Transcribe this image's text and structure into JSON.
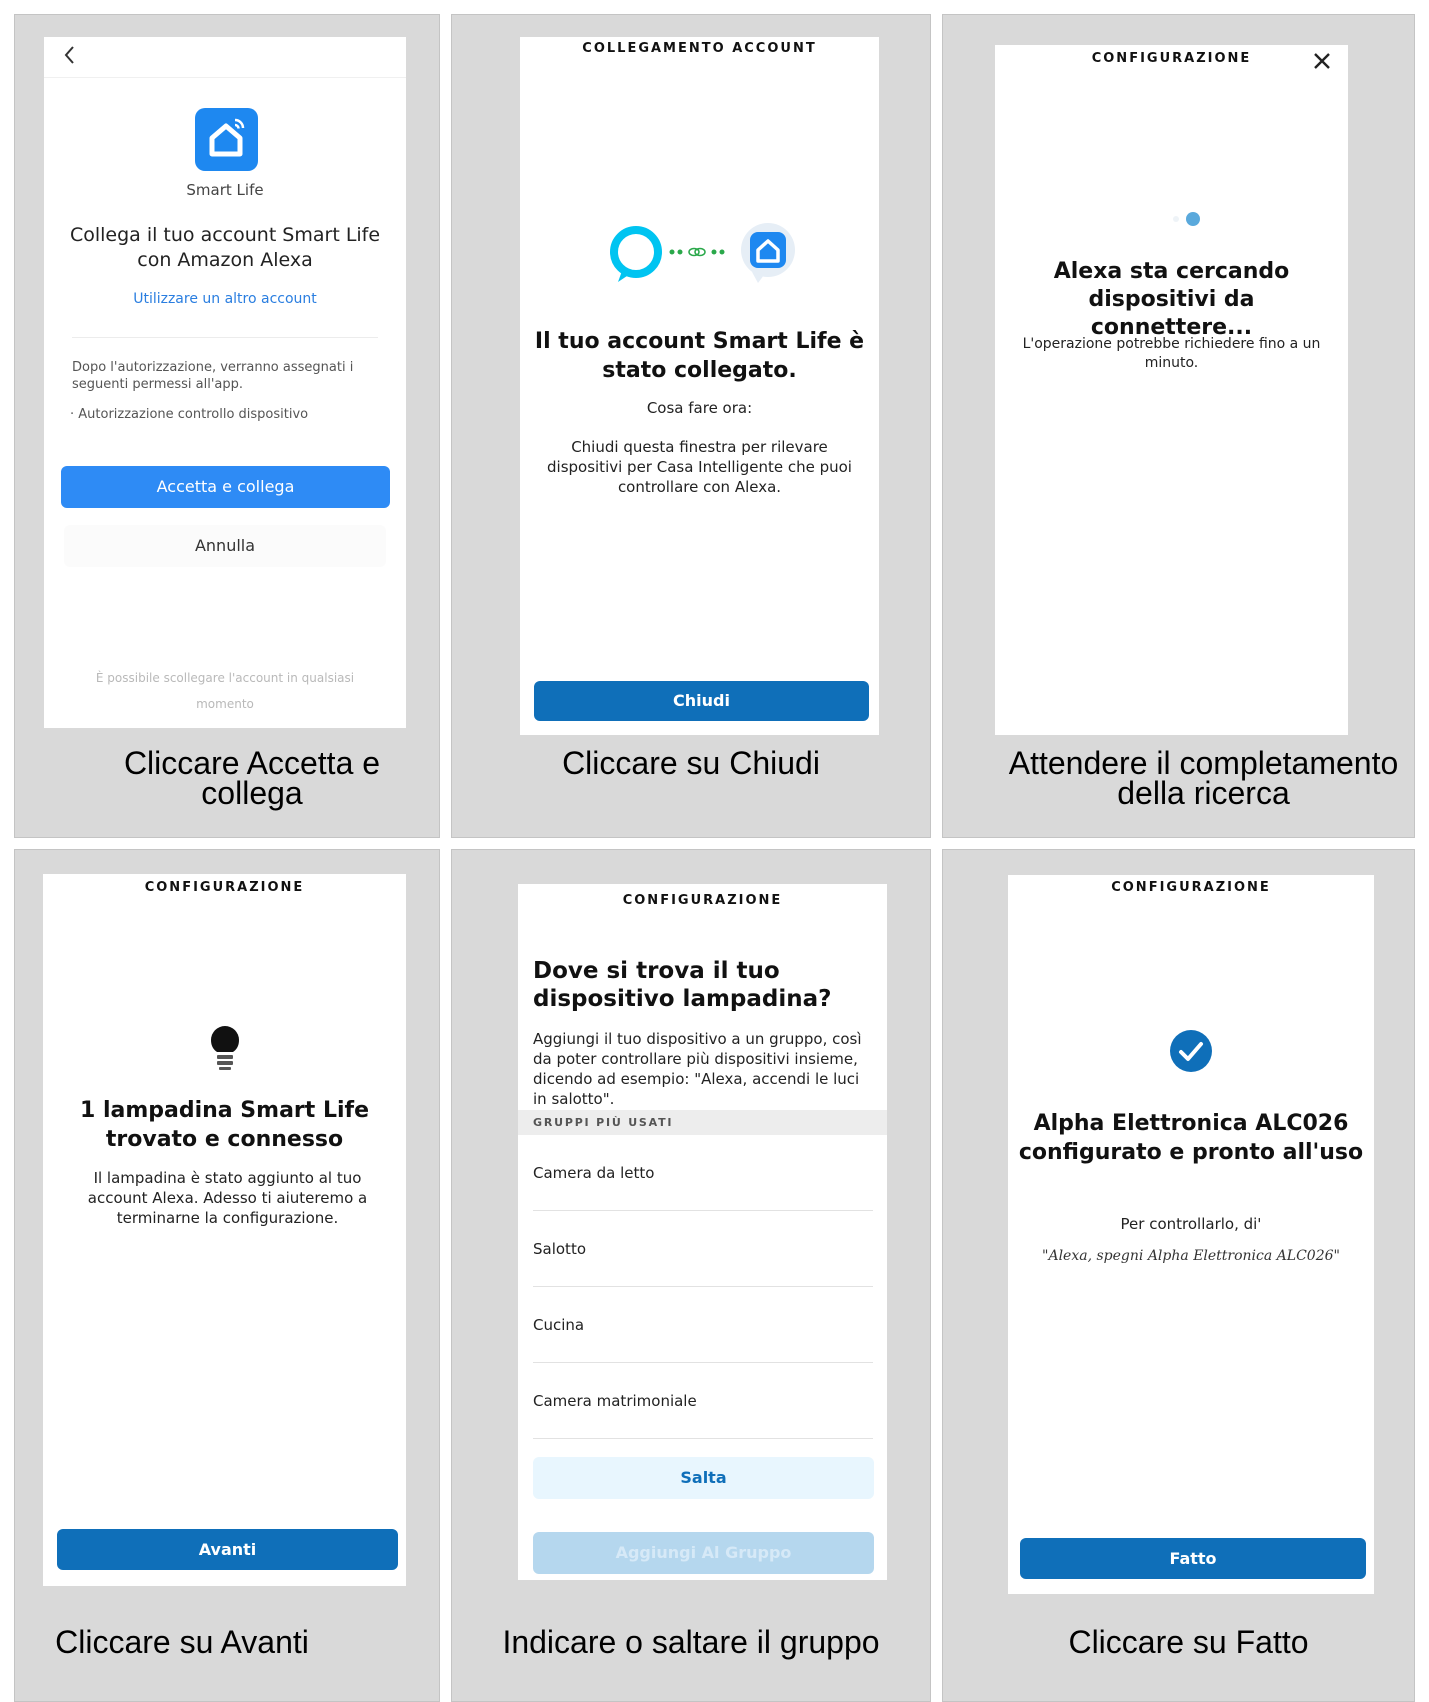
{
  "panels": [
    {
      "caption": "Cliccare Accetta e collega",
      "back_glyph": "‹",
      "app_name": "Smart Life",
      "title": "Collega il tuo account Smart Life con Amazon Alexa",
      "alt_account_link": "Utilizzare un altro account",
      "permissions_intro": "Dopo l'autorizzazione, verranno assegnati i seguenti permessi all'app.",
      "permission_item": "· Autorizzazione controllo dispositivo",
      "accept_button": "Accetta e collega",
      "cancel_button": "Annulla",
      "footer_note": "È possibile scollegare l'account in qualsiasi momento",
      "icons": [
        "back-arrow-icon",
        "smart-life-home-icon"
      ],
      "colors": {
        "accent": "#2e8bf5",
        "link": "#2a7ee0"
      }
    },
    {
      "caption": "Cliccare su Chiudi",
      "header": "COLLEGAMENTO ACCOUNT",
      "title": "Il tuo account Smart Life è stato collegato.",
      "next_heading": "Cosa fare ora:",
      "body": "Chiudi questa finestra per rilevare dispositivi per Casa Intelligente che puoi controllare con Alexa.",
      "close_button": "Chiudi",
      "icons": [
        "alexa-ring-icon",
        "link-icon",
        "smart-life-badge-icon"
      ]
    },
    {
      "caption": "Attendere il completamento della ricerca",
      "header": "CONFIGURAZIONE",
      "close_glyph": "✕",
      "title": "Alexa sta cercando dispositivi da connettere...",
      "subtitle": "L'operazione potrebbe richiedere fino a un minuto.",
      "icons": [
        "close-icon",
        "loading-dots-icon"
      ]
    },
    {
      "caption": "Cliccare su Avanti",
      "header": "CONFIGURAZIONE",
      "title": "1 lampadina Smart Life trovato e connesso",
      "body": "Il lampadina è stato aggiunto al tuo account Alexa. Adesso ti aiuteremo a terminarne la configurazione.",
      "next_button": "Avanti",
      "icons": [
        "lightbulb-icon"
      ]
    },
    {
      "caption": "Indicare o saltare il gruppo",
      "header": "CONFIGURAZIONE",
      "title": "Dove si trova il tuo dispositivo lampadina?",
      "body": "Aggiungi il tuo dispositivo a un gruppo, così da poter controllare più dispositivi insieme, dicendo ad esempio: \"Alexa, accendi le luci in salotto\".",
      "section_label": "GRUPPI PIÙ USATI",
      "groups": [
        "Camera da letto",
        "Salotto",
        "Cucina",
        "Camera matrimoniale"
      ],
      "skip_button": "Salta",
      "add_button": "Aggiungi Al Gruppo"
    },
    {
      "caption": "Cliccare su Fatto",
      "header": "CONFIGURAZIONE",
      "title": "Alpha Elettronica ALC026 configurato e pronto all'uso",
      "how_to": "Per controllarlo, di'",
      "example_phrase": "\"Alexa, spegni Alpha Elettronica ALC026\"",
      "done_button": "Fatto",
      "icons": [
        "checkmark-circle-icon"
      ],
      "colors": {
        "primary": "#0f6fb9"
      }
    }
  ]
}
